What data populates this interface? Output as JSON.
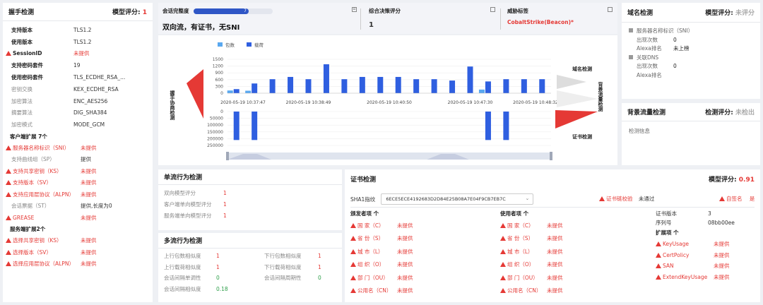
{
  "handshake": {
    "title": "握手检测",
    "score_label": "模型评分:",
    "score": "1",
    "rows": [
      {
        "k": "支持版本",
        "v": "TLS1.2",
        "bold": true,
        "alert": false,
        "vred": false
      },
      {
        "k": "使用版本",
        "v": "TLS1.2",
        "bold": true,
        "alert": false,
        "vred": false
      },
      {
        "k": "SessionID",
        "v": "未提供",
        "bold": true,
        "alert": true,
        "vred": true
      },
      {
        "k": "支持密码套件",
        "v": "19",
        "bold": true,
        "alert": false,
        "vred": false
      },
      {
        "k": "使用密码套件",
        "v": "TLS_ECDHE_RSA_...",
        "bold": true,
        "alert": false,
        "vred": false
      },
      {
        "k": "密钥交换",
        "v": "KEX_ECDHE_RSA",
        "bold": false,
        "alert": false,
        "vred": false
      },
      {
        "k": "加密算法",
        "v": "ENC_AES256",
        "bold": false,
        "alert": false,
        "vred": false
      },
      {
        "k": "摘要算法",
        "v": "DIG_SHA384",
        "bold": false,
        "alert": false,
        "vred": false
      },
      {
        "k": "加密模式",
        "v": "MODE_GCM",
        "bold": false,
        "alert": false,
        "vred": false
      }
    ],
    "client_ext_title": "客户端扩展 7个",
    "client_ext": [
      {
        "k": "服务器名称标识（SNI）",
        "v": "未提供",
        "alert": true,
        "vred": true
      },
      {
        "k": "支持曲线组（SP）",
        "v": "提供",
        "alert": false,
        "vred": false
      },
      {
        "k": "支持共享密钥（KS）",
        "v": "未提供",
        "alert": true,
        "vred": true
      },
      {
        "k": "支持版本（SV）",
        "v": "未提供",
        "alert": true,
        "vred": true
      },
      {
        "k": "支持应用层协议（ALPN）",
        "v": "未提供",
        "alert": true,
        "vred": true
      },
      {
        "k": "会话票据（ST）",
        "v": "提供,长度为0",
        "alert": false,
        "vred": false
      },
      {
        "k": "GREASE",
        "v": "未提供",
        "alert": true,
        "vred": true
      }
    ],
    "server_ext_title": "服务端扩展2个",
    "server_ext": [
      {
        "k": "选择共享密钥（KS）",
        "v": "未提供",
        "alert": true,
        "vred": true
      },
      {
        "k": "选择版本（SV）",
        "v": "未提供",
        "alert": true,
        "vred": true
      },
      {
        "k": "选择应用层协议（ALPN）",
        "v": "未提供",
        "alert": true,
        "vred": true
      }
    ]
  },
  "summary": {
    "integrity_label": "会话完整度",
    "integrity_value": "7",
    "integrity_fill": 0.7,
    "summary_text": "双向流，有证书，无SNI",
    "decision_label": "综合决策评分",
    "decision_value": "1",
    "threat_label": "威胁标签",
    "threat_value": "CobaltStrike(Beacon)*"
  },
  "flow": {
    "legend_packets": "包数",
    "legend_payload": "载荷",
    "left_label": "握手协商检测",
    "right_top_label": "域名检测",
    "right_mid_label": "背景流量检测",
    "right_bottom_label": "证书检测"
  },
  "chart_data": {
    "type": "bar",
    "title": "",
    "series": [
      {
        "name": "包数",
        "values": [
          120,
          160,
          110,
          0,
          0,
          0,
          0,
          0,
          0,
          0,
          0,
          0,
          0,
          0,
          0,
          0,
          0,
          0,
          0,
          0,
          0,
          0,
          0,
          0,
          0,
          0,
          0,
          110,
          160,
          90,
          0,
          0,
          0,
          0,
          0,
          0
        ]
      },
      {
        "name": "载荷",
        "values": [
          180,
          480,
          430,
          500,
          620,
          620,
          720,
          1280,
          620,
          720,
          1280,
          560,
          620,
          820,
          720,
          620,
          720,
          620,
          720,
          620,
          620,
          720,
          620,
          1050,
          560,
          720,
          1180,
          580,
          520,
          420,
          620,
          620,
          620,
          620,
          620,
          620
        ]
      }
    ],
    "x_tick_labels": [
      "2020-05-19 10:37:47",
      "2020-05-19 10:38:49",
      "2020-05-19 10:40:50",
      "2020-05-19 10:47:30",
      "2020-05-19 10:48:32"
    ],
    "y_upper_ticks": [
      "1500",
      "1200",
      "900",
      "600",
      "300",
      "0"
    ],
    "y_upper_lim": [
      0,
      1500
    ],
    "y_lower_ticks": [
      "0",
      "50000",
      "100000",
      "150000",
      "200000",
      "250000"
    ],
    "y_lower_lim": [
      0,
      250000
    ],
    "lower_values": [
      0,
      0,
      0,
      0,
      0,
      0,
      0,
      0,
      0,
      0,
      0,
      0,
      0,
      0,
      0,
      0,
      0,
      0,
      0,
      0,
      0,
      0,
      0,
      0,
      0,
      0,
      0,
      0,
      210000,
      210000,
      0,
      0,
      0,
      0,
      0,
      0
    ],
    "lower_values_first": [
      210000,
      210000
    ]
  },
  "single_flow": {
    "title": "单流行为检测",
    "rows": [
      {
        "k": "双向模型评分",
        "v": "1"
      },
      {
        "k": "客户端单向模型评分",
        "v": "1"
      },
      {
        "k": "服务端单向模型评分",
        "v": "1"
      }
    ]
  },
  "multi_flow": {
    "title": "多流行为检测",
    "rows": [
      {
        "k1": "上行包数相似度",
        "v1": "1",
        "c1": "red",
        "k2": "下行包数相似度",
        "v2": "1",
        "c2": "red"
      },
      {
        "k1": "上行载荷相似度",
        "v1": "1",
        "c1": "red",
        "k2": "下行载荷相似度",
        "v2": "1",
        "c2": "red"
      },
      {
        "k1": "会话间隔单调性",
        "v1": "0",
        "c1": "green",
        "k2": "会话间隔周期性",
        "v2": "0",
        "c2": "green"
      },
      {
        "k1": "会话间隔相似度",
        "v1": "0.18",
        "c1": "green",
        "k2": "",
        "v2": "",
        "c2": ""
      }
    ]
  },
  "cert": {
    "title": "证书检测",
    "score_label": "模型评分:",
    "score": "0.91",
    "sha1_label": "SHA1指纹",
    "sha1_value": "6ECE5ECE4192683D2D84E25B08A7E04F9CB7EB7C",
    "chain_label": "证书链校验",
    "chain_value": "未通过",
    "selfsigned_label": "自签名",
    "selfsigned_value": "是",
    "issuer_title": "颁发者项 个",
    "subject_title": "使用者项 个",
    "fields": [
      {
        "k": "国 家（C）",
        "v": "未提供"
      },
      {
        "k": "省 份（S）",
        "v": "未提供"
      },
      {
        "k": "城 市（L）",
        "v": "未提供"
      },
      {
        "k": "组 织（O）",
        "v": "未提供"
      },
      {
        "k": "部 门（OU）",
        "v": "未提供"
      },
      {
        "k": "公用名（CN）",
        "v": "未提供"
      }
    ],
    "version_label": "证书版本",
    "version_value": "3",
    "serial_label": "序列号",
    "serial_value": "08bb00ee",
    "ext_title": "扩展项 个",
    "ext": [
      {
        "k": "KeyUsage",
        "v": "未提供"
      },
      {
        "k": "CertPolicy",
        "v": "未提供"
      },
      {
        "k": "SAN",
        "v": "未提供"
      },
      {
        "k": "ExtendKeyUsage",
        "v": "未提供"
      }
    ]
  },
  "domain": {
    "title": "域名检测",
    "score_label": "模型评分:",
    "score": "未评分",
    "sni_title": "服务器名称标识（SNI）",
    "sni_count_label": "出现次数",
    "sni_count": "0",
    "sni_alexa_label": "Alexa排名",
    "sni_alexa": "未上榜",
    "dns_title": "关联DNS",
    "dns_count_label": "出现次数",
    "dns_count": "0",
    "dns_alexa_label": "Alexa排名",
    "dns_alexa": ""
  },
  "background": {
    "title": "背景流量检测",
    "score_label": "检测评分:",
    "score": "未检出",
    "info": "检测信息"
  }
}
